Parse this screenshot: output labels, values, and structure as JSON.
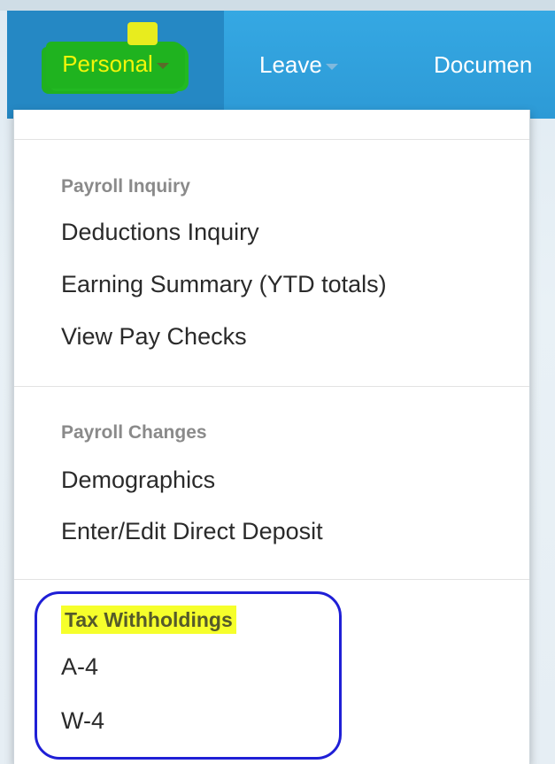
{
  "nav": {
    "personal": "Personal",
    "leave": "Leave",
    "documents": "Documen"
  },
  "menu": {
    "payroll_inquiry": {
      "header": "Payroll Inquiry",
      "items": [
        "Deductions Inquiry",
        "Earning Summary (YTD totals)",
        "View Pay Checks"
      ]
    },
    "payroll_changes": {
      "header": "Payroll Changes",
      "items": [
        "Demographics",
        "Enter/Edit Direct Deposit"
      ]
    },
    "tax_withholdings": {
      "header": "Tax Withholdings",
      "items": [
        "A-4",
        "W-4"
      ]
    }
  },
  "colors": {
    "navbar": "#2d9ad6",
    "active_tab": "#2588c4",
    "highlight_green": "#1fb31f",
    "highlight_yellow": "#f6ff2b",
    "annotation_circle": "#1f1fd6"
  },
  "icons": [
    "caret-down-icon"
  ]
}
